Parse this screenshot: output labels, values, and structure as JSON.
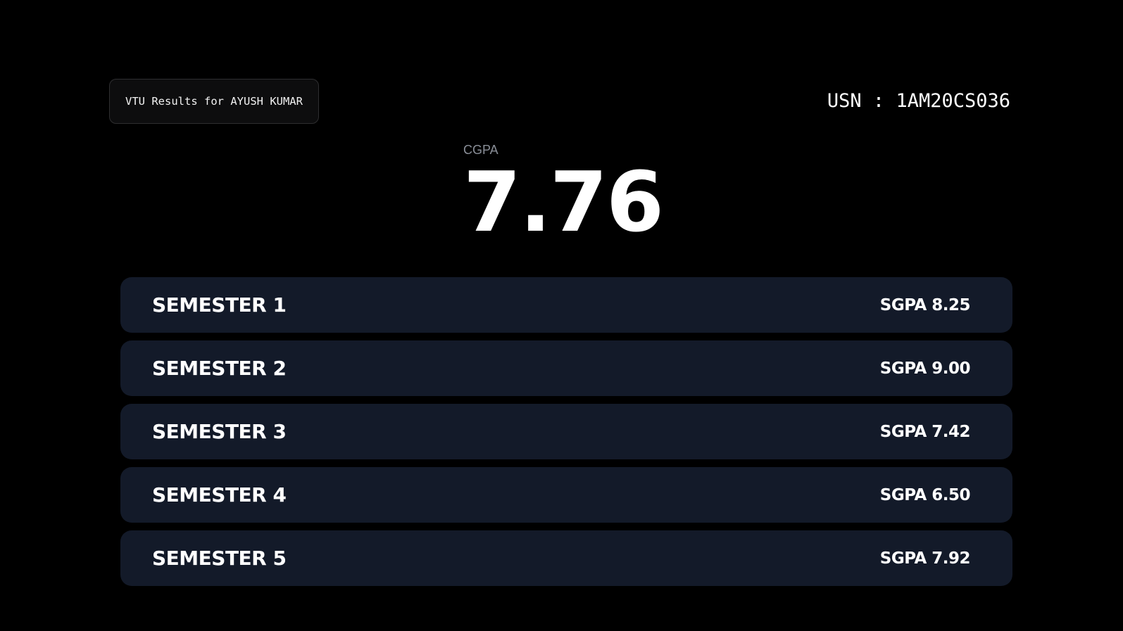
{
  "header": {
    "title": "VTU Results for AYUSH KUMAR",
    "usn": "USN : 1AM20CS036"
  },
  "cgpa": {
    "label": "CGPA",
    "value": "7.76"
  },
  "semesters": [
    {
      "name": "SEMESTER 1",
      "sgpa": "SGPA 8.25"
    },
    {
      "name": "SEMESTER 2",
      "sgpa": "SGPA 9.00"
    },
    {
      "name": "SEMESTER 3",
      "sgpa": "SGPA 7.42"
    },
    {
      "name": "SEMESTER 4",
      "sgpa": "SGPA 6.50"
    },
    {
      "name": "SEMESTER 5",
      "sgpa": "SGPA 7.92"
    }
  ],
  "colors": {
    "background": "#000000",
    "card": "#131a29",
    "muted_label": "#8a8f98"
  }
}
